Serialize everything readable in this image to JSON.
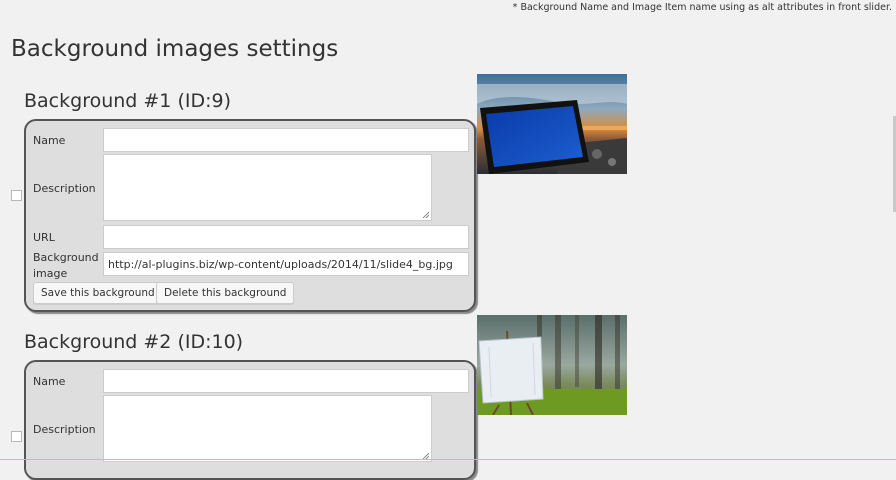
{
  "note": "* Background Name and Image Item name using as alt attributes in front slider.",
  "page_title": "Background images settings",
  "backgrounds": [
    {
      "title": "Background #1 (ID:9)",
      "labels": {
        "name": "Name",
        "description": "Description",
        "url": "URL",
        "background_image_line1": "Background",
        "background_image_line2": "image"
      },
      "name_value": "",
      "description_value": "",
      "url_value": "",
      "image_value": "http://al-plugins.biz/wp-content/uploads/2014/11/slide4_bg.jpg",
      "save_label": "Save this background",
      "delete_label": "Delete this background",
      "thumbnail_icon": "tablet-on-sunset-beach-image"
    },
    {
      "title": "Background #2 (ID:10)",
      "labels": {
        "name": "Name",
        "description": "Description"
      },
      "name_value": "",
      "description_value": "",
      "thumbnail_icon": "easel-in-forest-image"
    }
  ],
  "colors": {
    "page_bg": "#f1f1f1",
    "panel_bg": "#dedede",
    "panel_border": "#555555"
  }
}
